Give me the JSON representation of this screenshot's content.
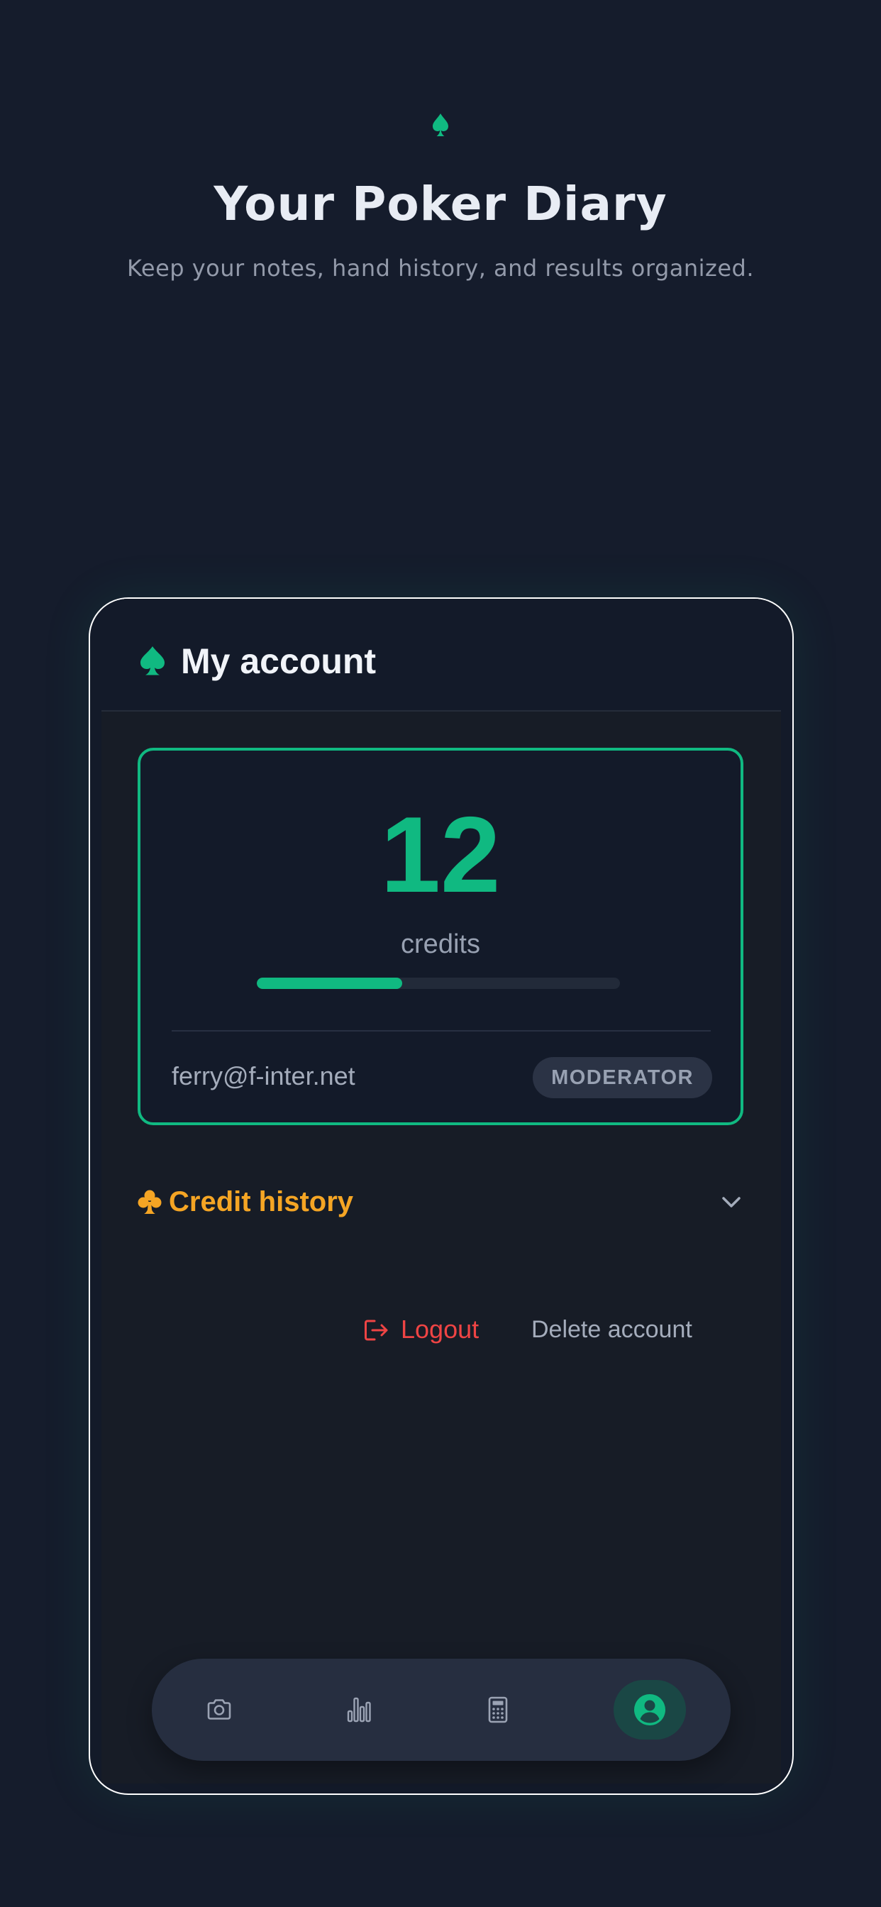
{
  "hero": {
    "icon": "spade-icon",
    "title": "Your Poker Diary",
    "subtitle": "Keep your notes, hand history, and results organized."
  },
  "header": {
    "icon": "spade-icon",
    "title": "My account"
  },
  "account": {
    "credits": "12",
    "credits_label": "credits",
    "credit_progress": 0.4,
    "email": "ferry@f-inter.net",
    "role": "MODERATOR"
  },
  "credit_history": {
    "icon": "club-icon",
    "label": "Credit history",
    "expanded": false
  },
  "actions": {
    "logout_label": "Logout",
    "delete_label": "Delete account"
  },
  "tabbar": {
    "tabs": [
      {
        "icon": "camera-icon",
        "active": false
      },
      {
        "icon": "bar-chart-icon",
        "active": false
      },
      {
        "icon": "calculator-icon",
        "active": false
      },
      {
        "icon": "user-circle-icon",
        "active": true
      }
    ]
  },
  "colors": {
    "background": "#151c2c",
    "accent": "#10b981",
    "warning": "#f5a524",
    "danger": "#ef4444"
  }
}
